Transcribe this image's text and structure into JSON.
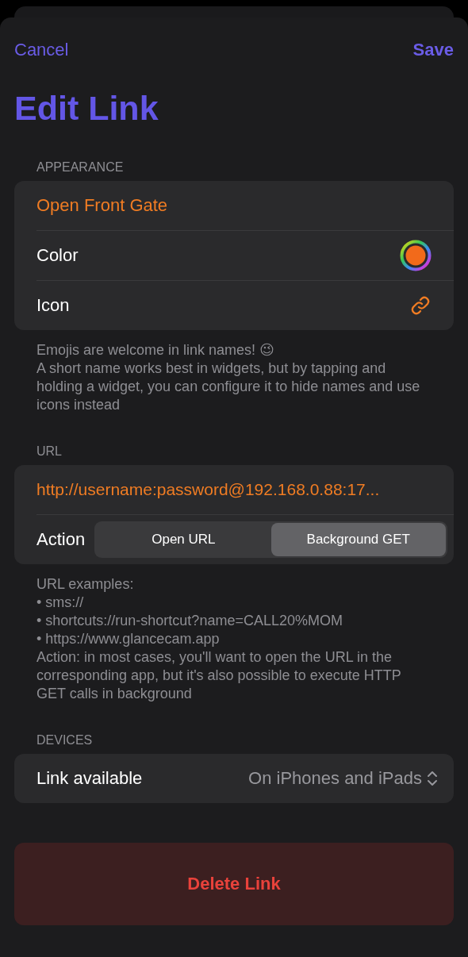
{
  "nav": {
    "cancel": "Cancel",
    "save": "Save"
  },
  "title": "Edit Link",
  "sections": [
    {
      "header": "APPEARANCE",
      "rows": [
        {
          "kind": "name",
          "value": "Open Front Gate"
        },
        {
          "kind": "color",
          "label": "Color",
          "color": "#f26a1b"
        },
        {
          "kind": "icon",
          "label": "Icon"
        }
      ],
      "footer": [
        "Emojis are welcome in link names! 😉",
        "A short name works best in widgets, but by tapping and holding a widget, you can configure it to hide names and use icons instead"
      ]
    },
    {
      "header": "URL",
      "rows": [
        {
          "kind": "url",
          "value": "http://username:password@192.168.0.88:17..."
        },
        {
          "kind": "segmented",
          "label": "Action",
          "options": [
            {
              "label": "Open URL",
              "selected": false
            },
            {
              "label": "Background GET",
              "selected": true
            }
          ]
        }
      ],
      "footer": [
        "URL examples:",
        "• sms://",
        "• shortcuts://run-shortcut?name=CALL20%MOM",
        "• https://www.glancecam.app",
        "Action: in most cases, you'll want to open the URL in the corresponding app, but it's also possible to execute HTTP GET calls in background"
      ]
    },
    {
      "header": "DEVICES",
      "rows": [
        {
          "kind": "picker",
          "label": "Link available",
          "value": "On iPhones and iPads"
        }
      ]
    }
  ],
  "delete": "Delete Link"
}
